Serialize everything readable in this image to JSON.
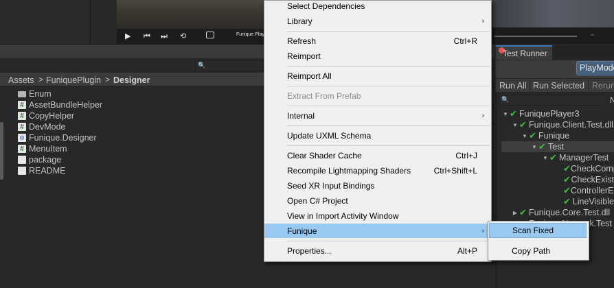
{
  "player": {
    "title": "Funique Play",
    "play_icon": "▶",
    "prev_icon": "⏮",
    "next_icon": "⏭",
    "loop_icon": "⟲",
    "time_dash": "--"
  },
  "project": {
    "breadcrumb": [
      "Assets",
      "FuniquePlugin",
      "Designer"
    ],
    "separator": ">",
    "search_icon": "🔍",
    "files": [
      {
        "name": "Enum",
        "icon": "folder-icon"
      },
      {
        "name": "AssetBundleHelper",
        "icon": "csharp-script-icon",
        "glyph": "#"
      },
      {
        "name": "CopyHelper",
        "icon": "csharp-script-icon",
        "glyph": "#"
      },
      {
        "name": "DevMode",
        "icon": "csharp-script-icon",
        "glyph": "#"
      },
      {
        "name": "Funique.Designer",
        "icon": "assembly-definition-icon",
        "glyph": "⚙"
      },
      {
        "name": "MenuItem",
        "icon": "csharp-script-icon",
        "glyph": "#"
      },
      {
        "name": "package",
        "icon": "package-file-icon",
        "glyph": ""
      },
      {
        "name": "README",
        "icon": "text-file-icon",
        "glyph": ""
      }
    ]
  },
  "test_runner": {
    "tab_label": "Test Runner",
    "mode_button": "PlayMode",
    "run_all": "Run All",
    "run_selected": "Run Selected",
    "rerun": "Rerun",
    "search_icon": "🔍",
    "n_button": "N",
    "tree": [
      {
        "label": "FuniquePlayer3",
        "indent": 0,
        "arrow": "▼",
        "check": "✔"
      },
      {
        "label": "Funique.Client.Test.dll",
        "indent": 1,
        "arrow": "▼",
        "check": "✔"
      },
      {
        "label": "Funique",
        "indent": 2,
        "arrow": "▼",
        "check": "✔"
      },
      {
        "label": "Test",
        "indent": 3,
        "arrow": "▼",
        "check": "✔",
        "selected": true
      },
      {
        "label": "ManagerTest",
        "indent": 4,
        "arrow": "▼",
        "check": "✔"
      },
      {
        "label": "CheckComponent",
        "indent": 5,
        "arrow": "",
        "check": "✔"
      },
      {
        "label": "CheckExist",
        "indent": 5,
        "arrow": "",
        "check": "✔"
      },
      {
        "label": "ControllerExist",
        "indent": 5,
        "arrow": "",
        "check": "✔"
      },
      {
        "label": "LineVisible",
        "indent": 5,
        "arrow": "",
        "check": "✔"
      },
      {
        "label": "Funique.Core.Test.dll",
        "indent": 1,
        "arrow": "▶",
        "check": "✔"
      },
      {
        "label": "Funique.Network.Test",
        "indent": 1,
        "arrow": "▶",
        "check": "✔"
      }
    ]
  },
  "context_menu": {
    "items": [
      {
        "label": "Select Dependencies",
        "shortcut": "",
        "submenu": false
      },
      {
        "label": "Library",
        "shortcut": "",
        "submenu": true
      },
      {
        "label": "Refresh",
        "shortcut": "Ctrl+R",
        "submenu": false
      },
      {
        "label": "Reimport",
        "shortcut": "",
        "submenu": false
      },
      {
        "label": "Reimport All",
        "shortcut": "",
        "submenu": false
      },
      {
        "label": "Extract From Prefab",
        "shortcut": "",
        "submenu": false,
        "disabled": true
      },
      {
        "label": "Internal",
        "shortcut": "",
        "submenu": true
      },
      {
        "label": "Update UXML Schema",
        "shortcut": "",
        "submenu": false
      },
      {
        "label": "Clear Shader Cache",
        "shortcut": "Ctrl+J",
        "submenu": false
      },
      {
        "label": "Recompile Lightmapping Shaders",
        "shortcut": "Ctrl+Shift+L",
        "submenu": false
      },
      {
        "label": "Seed XR Input Bindings",
        "shortcut": "",
        "submenu": false
      },
      {
        "label": "Open C# Project",
        "shortcut": "",
        "submenu": false
      },
      {
        "label": "View in Import Activity Window",
        "shortcut": "",
        "submenu": false
      },
      {
        "label": "Funique",
        "shortcut": "",
        "submenu": true,
        "highlighted": true
      },
      {
        "label": "Properties...",
        "shortcut": "Alt+P",
        "submenu": false
      }
    ],
    "arrow_glyph": "›"
  },
  "submenu": {
    "items": [
      {
        "label": "Scan Fixed",
        "highlighted": true
      },
      {
        "label": "Copy Path"
      }
    ]
  },
  "colors": {
    "highlight": "#99c8f0",
    "pass_check": "#3fbf3f",
    "accent_button": "#46607c"
  }
}
